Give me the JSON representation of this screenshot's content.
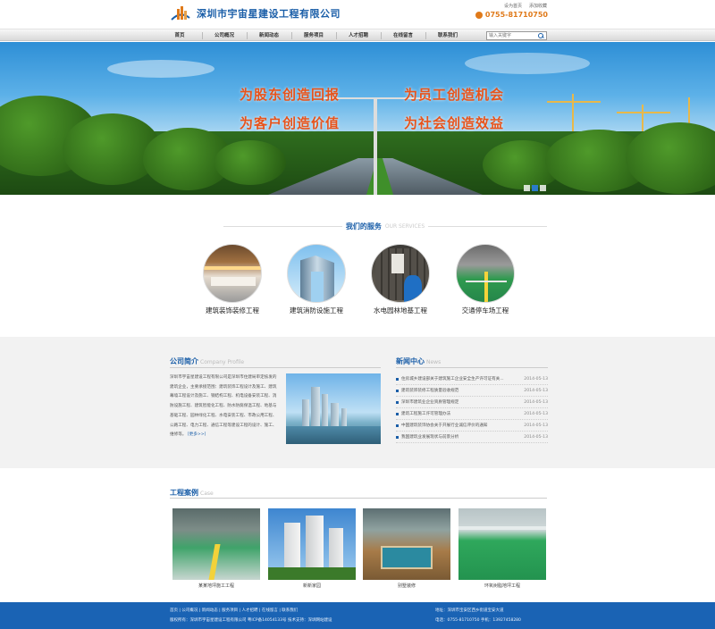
{
  "header": {
    "company_name": "深圳市宇宙星建设工程有限公司",
    "link_home": "设为首页",
    "link_fav": "添加收藏",
    "phone": "0755-81710750"
  },
  "nav": {
    "items": [
      "首页",
      "公司概况",
      "新闻动态",
      "服务项目",
      "人才招聘",
      "在线留言",
      "联系我们"
    ],
    "search_placeholder": "输入关键字"
  },
  "banner": {
    "slogans": [
      "为股东创造回报",
      "为员工创造机会",
      "为客户创造价值",
      "为社会创造效益"
    ],
    "slide_count": 3,
    "active_slide": 2
  },
  "services": {
    "title": "我们的服务",
    "title_en": "OUR SERVICES",
    "items": [
      {
        "label": "建筑装饰装修工程",
        "icon": "office-interior-image"
      },
      {
        "label": "建筑消防设施工程",
        "icon": "tower-building-image"
      },
      {
        "label": "水电园林地基工程",
        "icon": "worker-image"
      },
      {
        "label": "交通停车场工程",
        "icon": "parking-lot-image"
      }
    ]
  },
  "profile": {
    "title": "公司简介",
    "title_en": "Company Profile",
    "text": "深圳市宇宙星建设工程有限公司是深圳市住建局审定核发的建筑企业，主要承接范围：建筑装饰工程设计及施工、建筑幕墙工程设计及施工、钢结构工程、机电设备安装工程、消防设施工程、建筑智能化工程、防水防腐保温工程、地基与基础工程、园林绿化工程、水电安装工程、市政公用工程、公路工程、电力工程、通信工程等建设工程的设计、施工、维修等。",
    "more": "[更多>>]"
  },
  "news": {
    "title": "新闻中心",
    "title_en": "News",
    "items": [
      {
        "title": "住房城乡建设部关于建筑施工企业安全生产许可证有关...",
        "date": "2014-05-13"
      },
      {
        "title": "建筑装饰装修工程质量验收规范",
        "date": "2014-05-13"
      },
      {
        "title": "深圳市建筑业企业资质管理规定",
        "date": "2014-05-13"
      },
      {
        "title": "建筑工程施工许可管理办法",
        "date": "2014-05-13"
      },
      {
        "title": "中国建筑装饰协会关于开展行业诚信评价的通知",
        "date": "2014-05-13"
      },
      {
        "title": "我国建筑业发展现状与前景分析",
        "date": "2014-05-13"
      }
    ]
  },
  "cases": {
    "title": "工程案例",
    "title_en": "Case",
    "items": [
      {
        "label": "某某地坪施工工程"
      },
      {
        "label": "新新家园"
      },
      {
        "label": "别墅装修"
      },
      {
        "label": "环氧树脂地坪工程"
      }
    ]
  },
  "footer": {
    "links": "首页 | 公司概况 | 新闻动态 | 服务项目 | 人才招聘 | 在线留言 | 联系我们",
    "copyright": "版权所有：深圳市宇宙星建设工程有限公司 粤ICP备14054133号   技术支持：深圳网站建设",
    "address": "地址：深圳市宝安区西乡街道宝安大道",
    "tel": "电话：0755-81710750   手机：13927458280"
  },
  "colors": {
    "brand_blue": "#1a5ea8",
    "accent_orange": "#e8531a",
    "footer_blue": "#1a63b4"
  }
}
